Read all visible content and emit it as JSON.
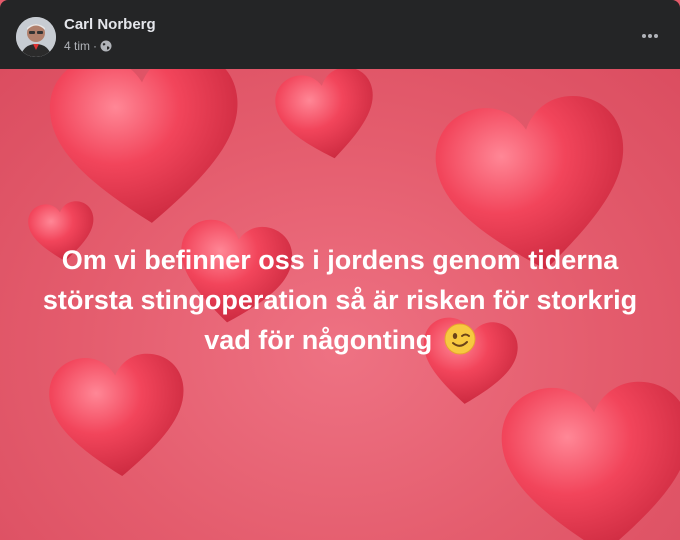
{
  "post": {
    "author": "Carl Norberg",
    "time": "4 tim",
    "separator": "·",
    "privacy_icon": "globe-icon",
    "more_icon": "more-options-icon",
    "text": "Om vi befinner oss i jordens genom tiderna största stingoperation så är risken för storkrig vad för någonting",
    "emoji": "winking-face-emoji",
    "background": "hearts",
    "colors": {
      "header_bg": "#242526",
      "name": "#e4e6eb",
      "meta": "#b0b3b8",
      "background": "#e45a6a",
      "heart": "#ef3e55"
    }
  }
}
